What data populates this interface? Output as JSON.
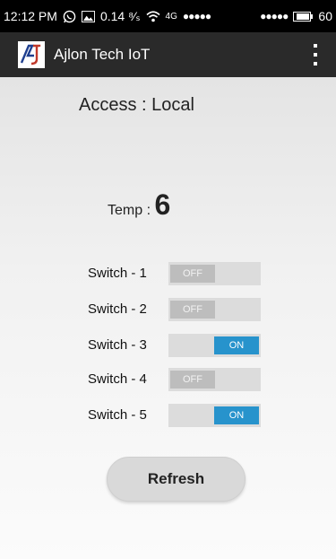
{
  "status_bar": {
    "time": "12:12 PM",
    "data_rate": "0.14 ⁸⁄ₛ",
    "network": "4G",
    "signal_dots_1": "●●●●●",
    "signal_dots_2": "●●●●●",
    "battery": "60",
    "icons": [
      "whatsapp-icon",
      "image-icon",
      "wifi-icon",
      "battery-icon"
    ]
  },
  "app_bar": {
    "logo_text": "AJ",
    "title": "Ajlon Tech IoT",
    "menu_icon": "overflow-menu-icon"
  },
  "main": {
    "access_text": "Access : Local",
    "temp_label": "Temp :",
    "temp_value": "6",
    "switches": [
      {
        "label": "Switch - 1",
        "state_text": "OFF",
        "on": false
      },
      {
        "label": "Switch - 2",
        "state_text": "OFF",
        "on": false
      },
      {
        "label": "Switch - 3",
        "state_text": "ON",
        "on": true
      },
      {
        "label": "Switch - 4",
        "state_text": "OFF",
        "on": false
      },
      {
        "label": "Switch - 5",
        "state_text": "ON",
        "on": true
      }
    ],
    "refresh_label": "Refresh"
  },
  "colors": {
    "toggle_on": "#2793cc",
    "toggle_off_thumb": "#bdbdbd",
    "app_bar": "#2a2a2a"
  }
}
